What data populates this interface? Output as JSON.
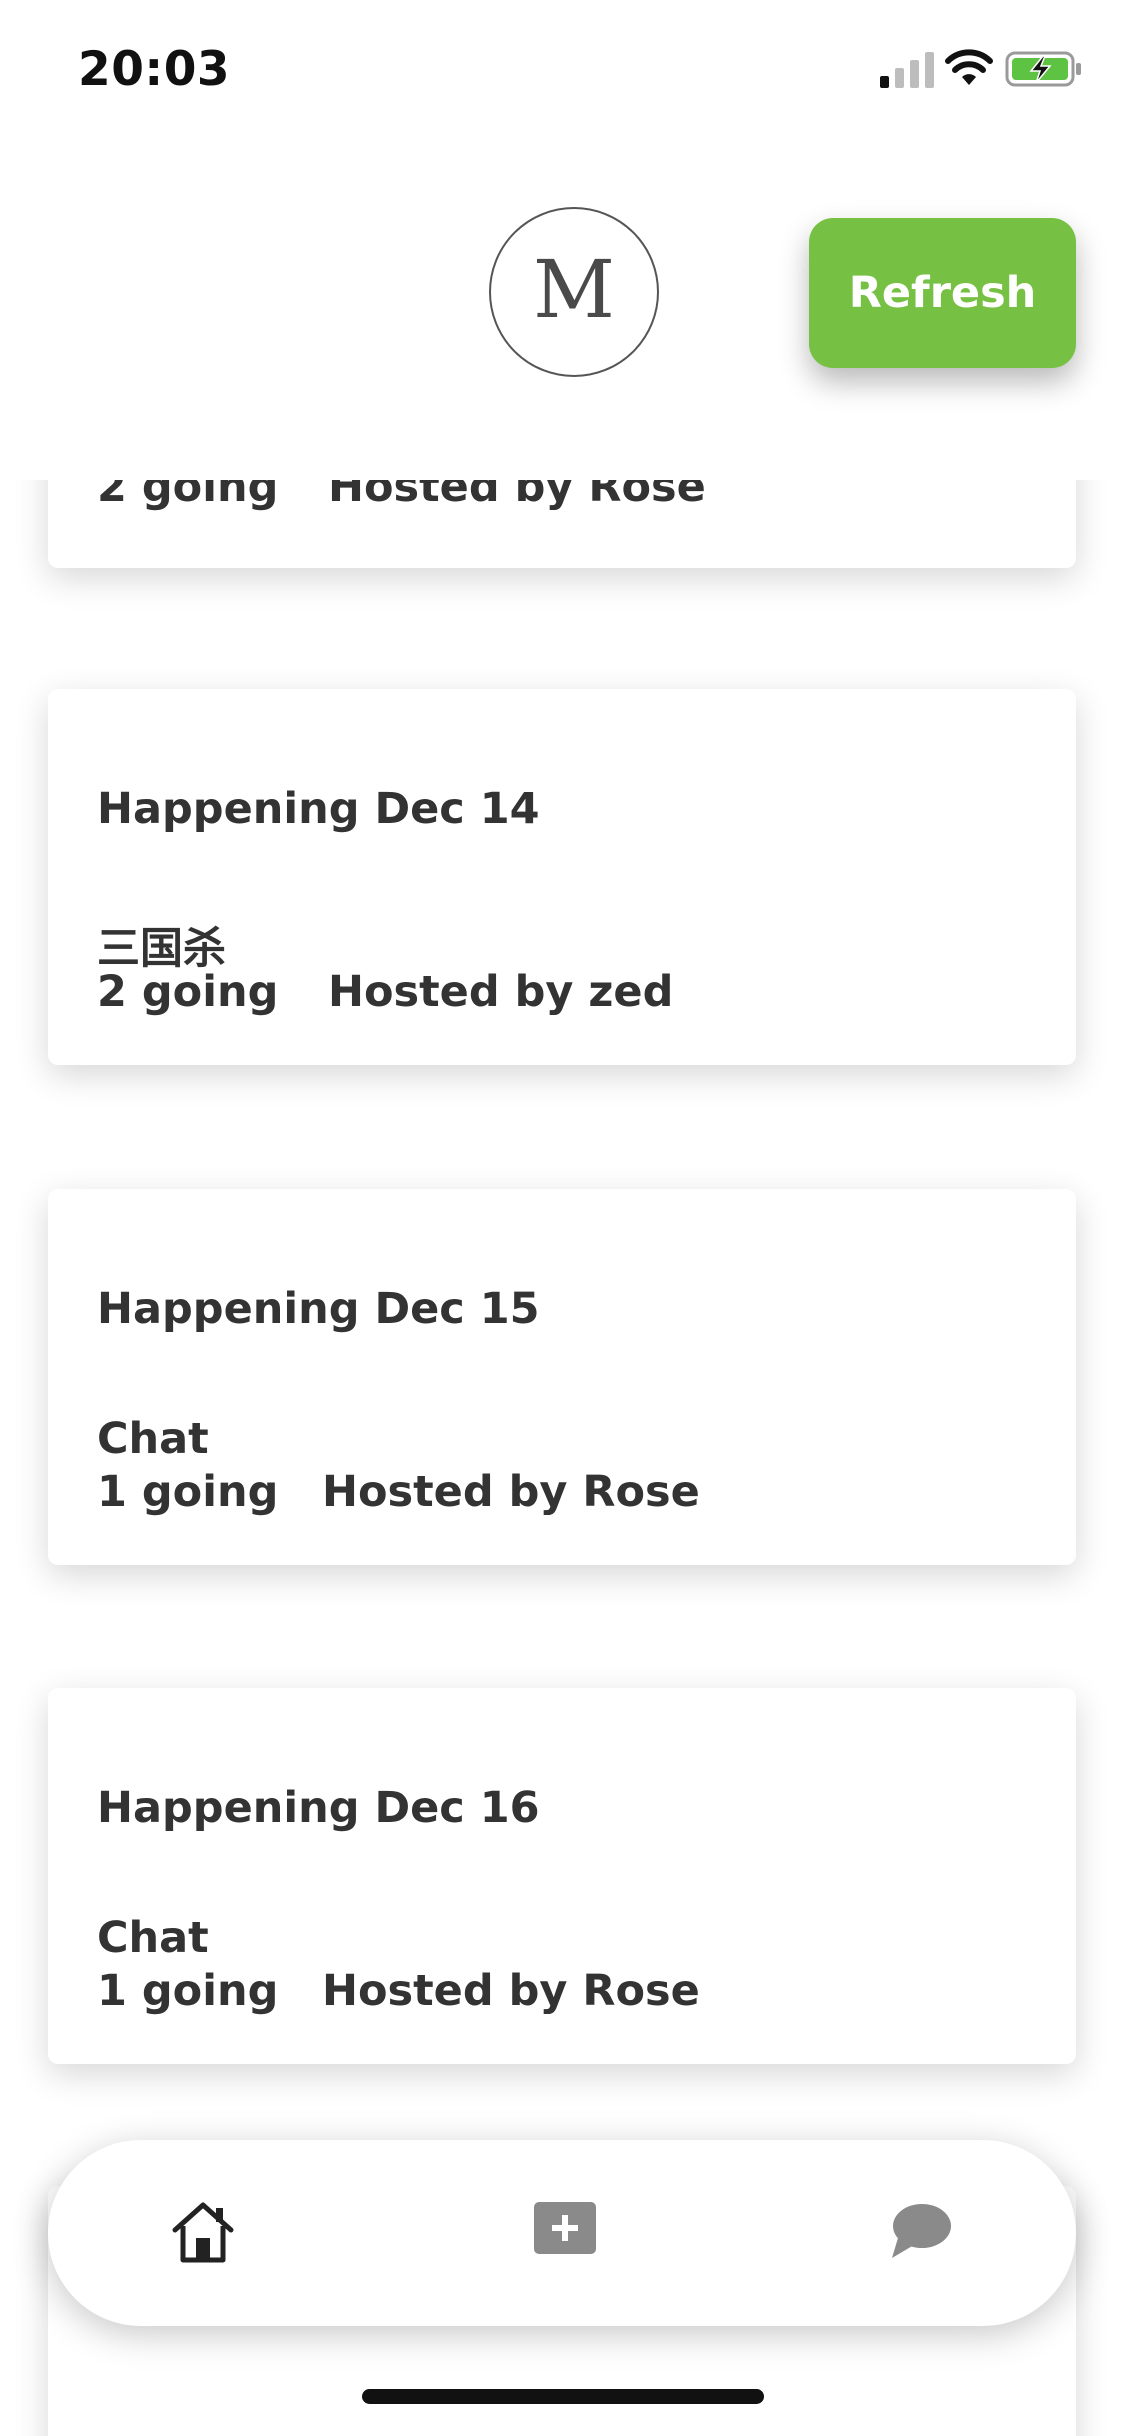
{
  "status_bar": {
    "time": "20:03",
    "icons": [
      "cellular-signal-icon",
      "wifi-icon",
      "battery-charging-icon"
    ]
  },
  "header": {
    "logo_letter": "M",
    "refresh_label": "Refresh"
  },
  "colors": {
    "accent_green": "#76c043",
    "text": "#333333",
    "nav_icon": "#8a8a8a"
  },
  "events": [
    {
      "date": "",
      "title": "",
      "going": "2 going",
      "host": "Hosted by Rose"
    },
    {
      "date": "Happening Dec 14",
      "title": "三国杀",
      "going": "2 going",
      "host": "Hosted by zed"
    },
    {
      "date": "Happening Dec 15",
      "title": "Chat",
      "going": "1 going",
      "host": "Hosted by Rose"
    },
    {
      "date": "Happening Dec 16",
      "title": "Chat",
      "going": "1 going",
      "host": "Hosted by Rose"
    }
  ],
  "bottom_nav": {
    "items": [
      "home-icon",
      "add-event-icon",
      "chat-icon"
    ]
  }
}
